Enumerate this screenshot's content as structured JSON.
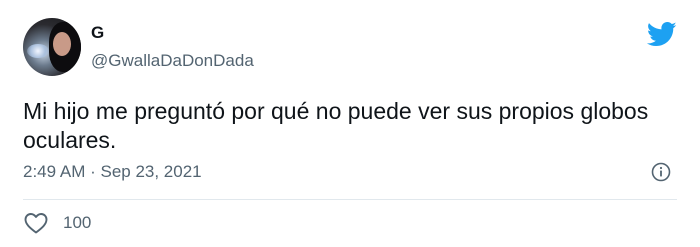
{
  "user": {
    "display_name": "G",
    "handle": "@GwallaDaDonDada",
    "avatar_icon": "avatar-photo"
  },
  "tweet": {
    "text": "Mi hijo me preguntó por qué no puede ver sus propios globos oculares.",
    "timestamp": "2:49 AM · Sep 23, 2021"
  },
  "actions": {
    "like_icon": "heart-icon",
    "like_count": "100",
    "info_icon": "info-icon"
  },
  "brand": {
    "logo_icon": "twitter-bird-icon",
    "accent_color": "#1DA1F2",
    "muted_text_color": "#536471"
  }
}
